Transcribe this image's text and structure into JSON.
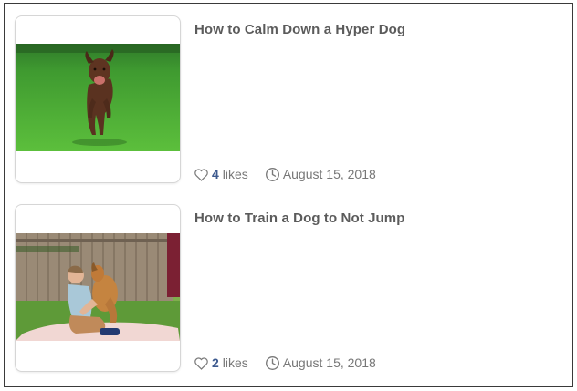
{
  "posts": [
    {
      "title": "How to Calm Down a Hyper Dog",
      "likes_count": "4",
      "likes_label": "likes",
      "date": "August 15, 2018",
      "image": "running-brown-dog-on-grass"
    },
    {
      "title": "How to Train a Dog to Not Jump",
      "likes_count": "2",
      "likes_label": "likes",
      "date": "August 15, 2018",
      "image": "boy-hugging-puppy-on-blanket"
    }
  ],
  "colors": {
    "title": "#5b5b5b",
    "likes_count": "#3d5a8f",
    "meta_text": "#777777",
    "border": "#d6d6d6"
  }
}
